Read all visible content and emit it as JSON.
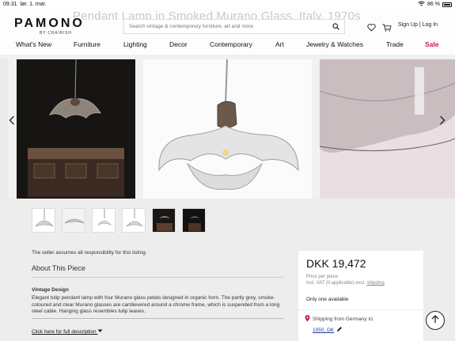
{
  "status": {
    "time": "09.31",
    "date": "lør. 1. mar.",
    "battery": "86 %"
  },
  "header": {
    "ghost_title": "Pendant Lamp in Smoked Murano Glass, Italy, 1970s",
    "logo": "PAMONO",
    "logo_sub": "BY CHAIRISH",
    "search_placeholder": "Search vintage & contemporary furniture, art and more",
    "auth": "Sign Up | Log In"
  },
  "nav": {
    "items": [
      "What's New",
      "Furniture",
      "Lighting",
      "Decor",
      "Contemporary",
      "Art",
      "Jewelry & Watches",
      "Trade",
      "Sale"
    ]
  },
  "icons": {
    "search": "search-icon",
    "wishlist": "heart-icon",
    "cart": "cart-icon",
    "prev": "chevron-left-icon",
    "next": "chevron-right-icon",
    "location": "location-pin-icon",
    "edit": "pencil-icon",
    "top": "arrow-up-icon"
  },
  "details": {
    "seller_note": "The seller assumes all responsibility for this listing.",
    "about_heading": "About This Piece",
    "section_heading": "Vintage Design",
    "description": "Elegant tulip pendant lamp with four Murano glass petals designed in organic form. The partly grey, smoke-coloured and clear Murano glasses are cantilevered around a chrome frame, which is suspended from a long steel cable. Hanging glass resembles tulip leaves.",
    "full_description_link": "Click here for full description"
  },
  "price": {
    "amount": "DKK 19,472",
    "per_piece": "Price per piece",
    "vat_text": "Incl. VAT (if applicable) excl.",
    "shipping_link": "shipping",
    "availability": "Only one available",
    "ship_from": "Shipping from Germany to:",
    "zip": "1050, DK"
  },
  "colors": {
    "sale": "#c2185b",
    "link": "#1a3aa8",
    "location": "#c2185b"
  }
}
